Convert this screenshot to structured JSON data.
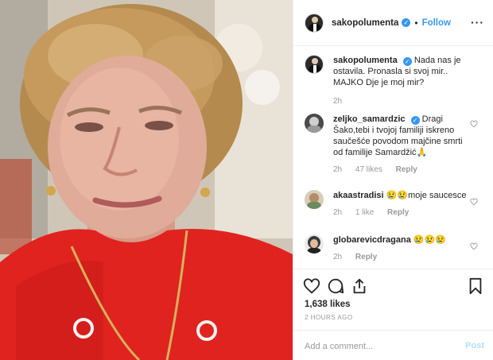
{
  "header": {
    "username": "sakopolumenta",
    "separator": "•",
    "follow_label": "Follow",
    "more_label": "···"
  },
  "caption": {
    "username": "sakopolumenta",
    "text": "Nada nas je ostavila. Pronasla si svoj mir.. MAJKO Dje je moj mir?",
    "time": "2h"
  },
  "comments": [
    {
      "username": "zeljko_samardzic",
      "text": "Dragi Šako,tebi i tvojoj familiji iskreno saučešće povodom majčine smrti od familije Samardžić🙏",
      "time": "2h",
      "likes": "47 likes",
      "reply_label": "Reply"
    },
    {
      "username": "akaastradisi",
      "text": "😢😢moje saucesce",
      "time": "2h",
      "likes": "1 like",
      "reply_label": "Reply"
    },
    {
      "username": "globarevicdragana",
      "text": "😢😢😢",
      "time": "2h",
      "reply_label": "Reply"
    }
  ],
  "actions": {
    "like_icon": "heart-icon",
    "comment_icon": "comment-icon",
    "share_icon": "share-icon",
    "save_icon": "bookmark-icon"
  },
  "likes_count": "1,638 likes",
  "timestamp": "2 HOURS AGO",
  "add_comment": {
    "placeholder": "Add a comment...",
    "post_label": "Post"
  },
  "colors": {
    "accent": "#3897f0",
    "post_disabled": "#b2dffc",
    "muted": "#999999"
  }
}
